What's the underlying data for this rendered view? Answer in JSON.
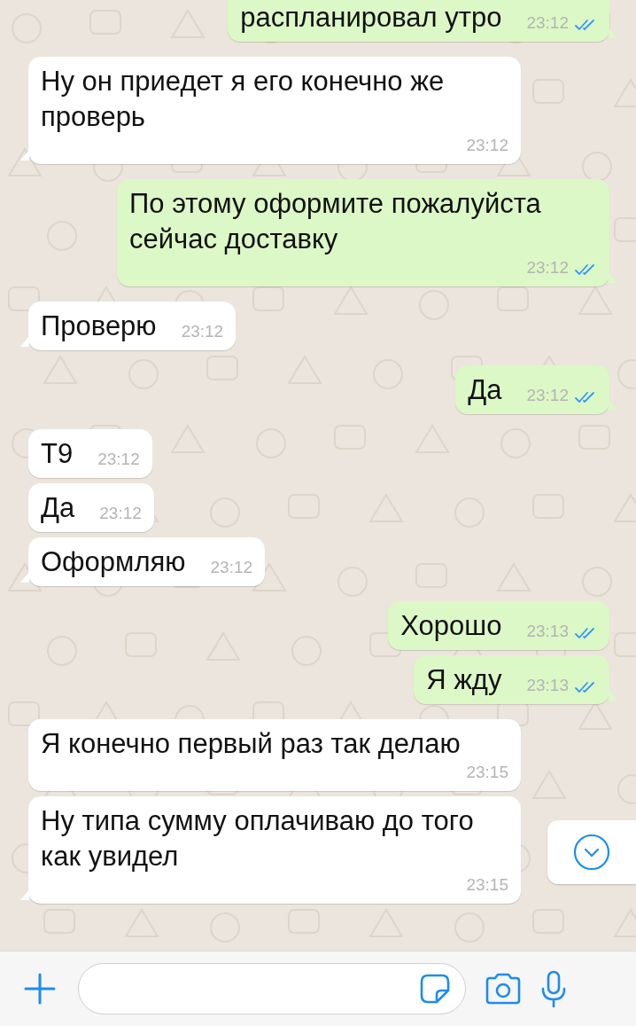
{
  "messages": [
    {
      "kind": "out",
      "text": "распланировал утро",
      "time": "23:12",
      "read": true,
      "tail": true
    },
    {
      "kind": "in",
      "text": "Ну он приедет я его конечно же проверь",
      "time": "23:12",
      "tail": true
    },
    {
      "kind": "out",
      "text": "По этому оформите пожалуйста сейчас доставку",
      "time": "23:12",
      "read": true,
      "tail": true
    },
    {
      "kind": "in",
      "text": "Проверю",
      "time": "23:12",
      "tail": true
    },
    {
      "kind": "out",
      "text": "Да",
      "time": "23:12",
      "read": true,
      "tail": true
    },
    {
      "kind": "in",
      "text": "Т9",
      "time": "23:12",
      "tail": false
    },
    {
      "kind": "in",
      "text": "Да",
      "time": "23:12",
      "tail": false
    },
    {
      "kind": "in",
      "text": "Оформляю",
      "time": "23:12",
      "tail": true
    },
    {
      "kind": "out",
      "text": "Хорошо",
      "time": "23:13",
      "read": true,
      "tail": false
    },
    {
      "kind": "out",
      "text": "Я жду",
      "time": "23:13",
      "read": true,
      "tail": true
    },
    {
      "kind": "in",
      "text": "Я конечно первый раз так делаю",
      "time": "23:15",
      "tail": false
    },
    {
      "kind": "in",
      "text": "Ну типа сумму оплачиваю до того как увидел",
      "time": "23:15",
      "tail": true
    }
  ],
  "composer": {
    "scroll_down": true
  }
}
